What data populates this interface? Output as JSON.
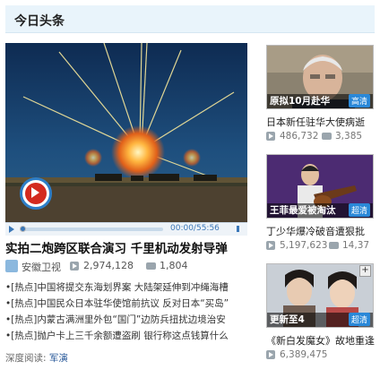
{
  "section": {
    "title": "今日头条"
  },
  "player": {
    "time": "00:00/55:56"
  },
  "headline": {
    "title": "实拍二炮跨区联合演习 千里机动发射导弹",
    "source": "安徽卫视",
    "views": "2,974,128",
    "comments": "1,804"
  },
  "news": [
    "•[热点]中国将提交东海划界案 大陆架延伸到冲绳海槽",
    "•[热点]中国民众日本驻华使馆前抗议 反对日本“买岛”",
    "•[热点]内蒙古满洲里外包“国门”边防兵扭扰边境治安",
    "•[热点]抛户卡上三千余额遭盗刷 银行称这点钱算什么"
  ],
  "related": {
    "label": "深度阅读:",
    "link": "军演"
  },
  "cards": [
    {
      "caption": "原拟10月赴华",
      "badge": "高清",
      "title": "日本新任驻华大使病逝",
      "views": "486,732",
      "comments": "3,385"
    },
    {
      "caption": "王菲最爱被淘汰",
      "badge": "超清",
      "title": "丁少华爆冷破音遭狠批",
      "views": "5,197,623",
      "comments": "14,37"
    },
    {
      "caption": "更新至4",
      "badge": "超清",
      "title": "《新白发魔女》故地重逢",
      "views": "6,389,475",
      "comments": ""
    }
  ],
  "colors": {
    "accent": "#2a88d8",
    "header_bg": "#e9f4fb",
    "play_red": "#d32a1f"
  }
}
